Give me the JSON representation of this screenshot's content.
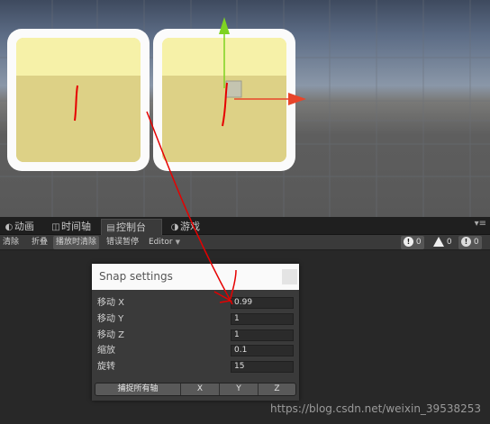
{
  "tabs": [
    {
      "icon": "animation-icon",
      "glyph": "◐",
      "label": "动画"
    },
    {
      "icon": "timeline-icon",
      "glyph": "◫",
      "label": "时间轴"
    },
    {
      "icon": "console-icon",
      "glyph": "▤",
      "label": "控制台"
    },
    {
      "icon": "game-icon",
      "glyph": "◑",
      "label": "游戏"
    }
  ],
  "toolbar": {
    "clear": "清除",
    "collapse": "折叠",
    "clear_on_play": "播放时清除",
    "error_pause": "错误暂停",
    "editor": "Editor",
    "errors": "0",
    "warnings": "0",
    "logs": "0"
  },
  "snap": {
    "title": "Snap settings",
    "rows": [
      {
        "label": "移动 X",
        "value": "0.99"
      },
      {
        "label": "移动 Y",
        "value": "1"
      },
      {
        "label": "移动 Z",
        "value": "1"
      },
      {
        "label": "缩放",
        "value": "0.1"
      },
      {
        "label": "旋转",
        "value": "15"
      }
    ],
    "buttons": {
      "snap_all": "捕捉所有轴",
      "x": "X",
      "y": "Y",
      "z": "Z"
    }
  },
  "watermark": "https://blog.csdn.net/weixin_39538253",
  "colors": {
    "x_axis": "#e8452a",
    "y_axis": "#7ed321",
    "annotation": "#e60000"
  }
}
